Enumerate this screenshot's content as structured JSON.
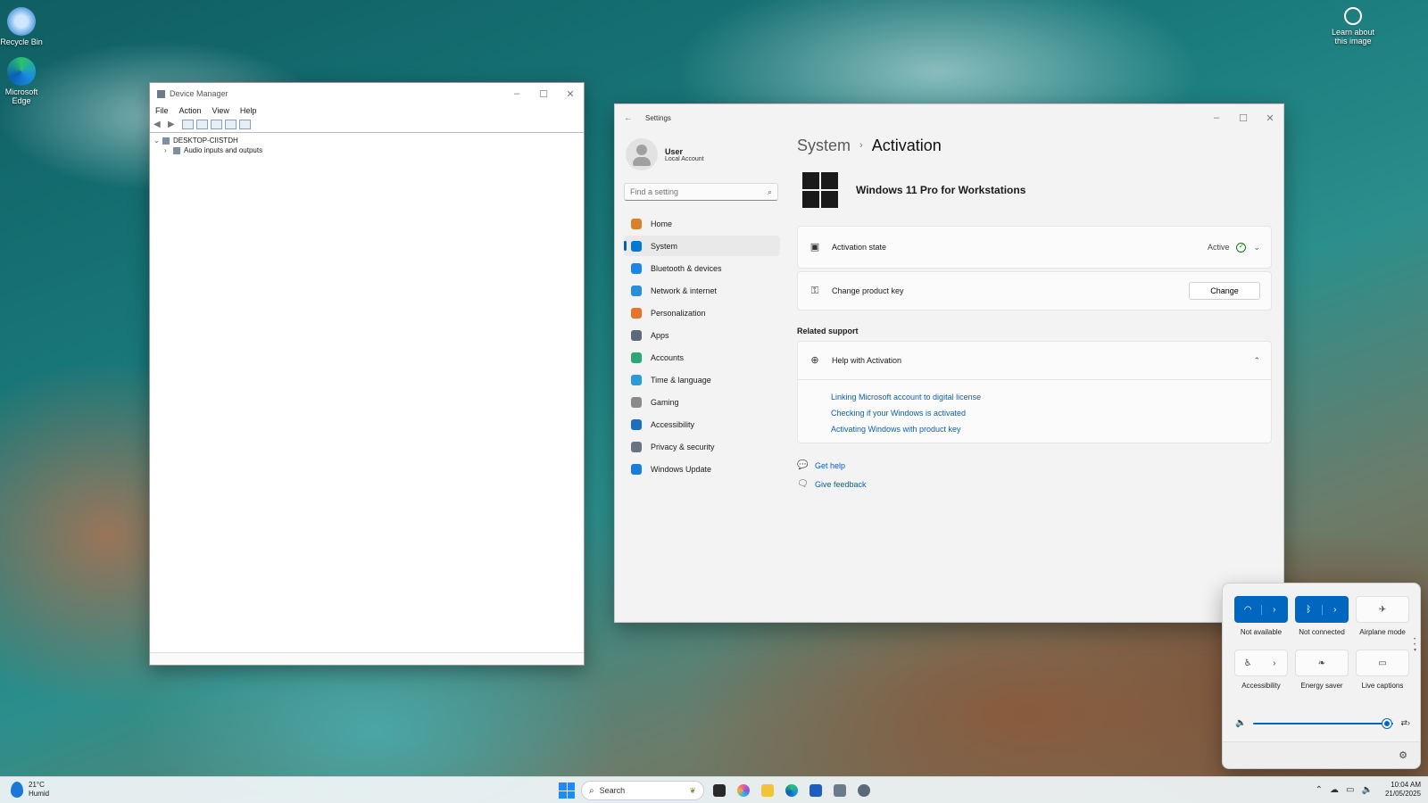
{
  "desktop": {
    "icons": [
      {
        "label": "Recycle Bin"
      },
      {
        "label": "Microsoft Edge"
      }
    ],
    "learn_label": "Learn about this image"
  },
  "device_manager": {
    "title": "Device Manager",
    "menu": [
      "File",
      "Action",
      "View",
      "Help"
    ],
    "tree": {
      "root": "DESKTOP-CIISTDH",
      "children": [
        "Audio inputs and outputs"
      ]
    }
  },
  "settings": {
    "title": "Settings",
    "user": {
      "name": "User",
      "account": "Local Account"
    },
    "search_placeholder": "Find a setting",
    "nav": [
      {
        "label": "Home",
        "color": "#d9822b"
      },
      {
        "label": "System",
        "color": "#0078d4"
      },
      {
        "label": "Bluetooth & devices",
        "color": "#1a86e8"
      },
      {
        "label": "Network & internet",
        "color": "#2a8ed8"
      },
      {
        "label": "Personalization",
        "color": "#e5732b"
      },
      {
        "label": "Apps",
        "color": "#5a6a7a"
      },
      {
        "label": "Accounts",
        "color": "#2aa876"
      },
      {
        "label": "Time & language",
        "color": "#2a9bd8"
      },
      {
        "label": "Gaming",
        "color": "#8a8a8a"
      },
      {
        "label": "Accessibility",
        "color": "#1a6fc0"
      },
      {
        "label": "Privacy & security",
        "color": "#6a7480"
      },
      {
        "label": "Windows Update",
        "color": "#1a7bd8"
      }
    ],
    "active_nav": "System",
    "breadcrumb": {
      "parent": "System",
      "current": "Activation"
    },
    "product_name": "Windows 11 Pro for Workstations",
    "activation_state": {
      "label": "Activation state",
      "status": "Active"
    },
    "product_key": {
      "label": "Change product key",
      "button": "Change"
    },
    "related_support": "Related support",
    "help": {
      "label": "Help with Activation",
      "links": [
        "Linking Microsoft account to digital license",
        "Checking if your Windows is activated",
        "Activating Windows with product key"
      ]
    },
    "footer_links": [
      "Get help",
      "Give feedback"
    ]
  },
  "quick_settings": {
    "tiles": [
      {
        "label": "Not available",
        "icon": "wifi-icon",
        "on": true,
        "split": true
      },
      {
        "label": "Not connected",
        "icon": "bluetooth-icon",
        "on": true,
        "split": true
      },
      {
        "label": "Airplane mode",
        "icon": "airplane-icon",
        "on": false,
        "split": false
      },
      {
        "label": "Accessibility",
        "icon": "accessibility-icon",
        "on": false,
        "split": true
      },
      {
        "label": "Energy saver",
        "icon": "leaf-icon",
        "on": false,
        "split": false
      },
      {
        "label": "Live captions",
        "icon": "captions-icon",
        "on": false,
        "split": false
      }
    ],
    "volume_level": 0.95
  },
  "taskbar": {
    "weather": {
      "temp": "21°C",
      "condition": "Humid"
    },
    "search_label": "Search",
    "clock": {
      "time": "10:04 AM",
      "date": "21/05/2025"
    }
  }
}
